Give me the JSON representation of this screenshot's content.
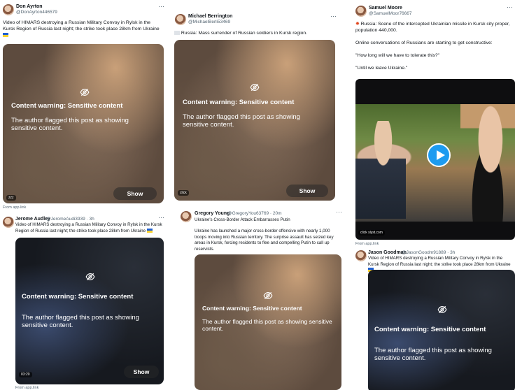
{
  "menu_glyph": "···",
  "warning": {
    "title": "Content warning: Sensitive content",
    "description": "The author flagged this post as showing sensitive content.",
    "show_label": "Show"
  },
  "colors": {
    "accent": "#1d9bf0",
    "text": "#0f1419",
    "muted": "#536471"
  },
  "posts": [
    {
      "name": "Don Ayrton",
      "handle": "@DonAyrton446579",
      "text": "Video of HIMARS destroying a Russian Military Convoy in Rylsk in the Kursk Region of Russia last night; the strike took place 28km from Ukraine",
      "source": "From app.link",
      "media_badge": "zzz"
    },
    {
      "name": "Michael Berrington",
      "handle": "@MichaelBerli53469",
      "text": "Russia: Mass surrender of Russian soldiers in Kursk region.",
      "media_badge": "click"
    },
    {
      "name": "Samuel Moore",
      "handle": "@SamuelMoor76667",
      "lines": [
        "Russia: Scene of the intercepted Ukrainian missile in Kursk city proper, population 440,000.",
        "Online conversations of Russians are starting to get constructive:",
        "\"How long will we have to tolerate this?\"",
        "\"Until we leave Ukraine.\""
      ],
      "source": "From app.link",
      "media_badge": "click slyst.com"
    },
    {
      "name": "Jerome Audley",
      "handle": "@JeromeAudi3939 · 3h",
      "text": "Video of HIMARS destroying a Russian Military Convoy in Rylsk in the Kursk Region of Russia last night; the strike took place 28km from Ukraine",
      "source": "From app.link",
      "media_badge": "03:20"
    },
    {
      "name": "Gregory Young",
      "handle": "@GregoryYou63769 · 20m",
      "subtitle": "Ukraine's Cross-Border Attack Embarrasses Putin",
      "text": "Ukraine has launched a major cross-border offensive with nearly 1,000 troops moving into Russian territory. The surprise assault has seized key areas in Kursk, forcing residents to flee and compelling Putin to call up reservists."
    },
    {
      "name": "Jason Goodman",
      "handle": "@JasonGoodm91889 · 3h",
      "text": "Video of HIMARS destroying a Russian Military Convoy in Rylsk in the Kursk Region of Russia last night; the strike took place 28km from Ukraine"
    }
  ]
}
